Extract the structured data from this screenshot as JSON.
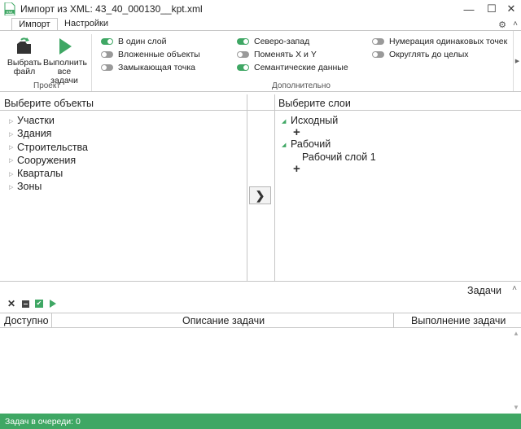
{
  "window": {
    "title": "Импорт из XML: 43_40_000130__kpt.xml",
    "icon": "xml-file-icon",
    "icon_label": "XML",
    "minimize_glyph": "—",
    "maximize_glyph": "☐",
    "close_glyph": "✕"
  },
  "tabs": [
    {
      "label": "Импорт",
      "active": true
    },
    {
      "label": "Настройки",
      "active": false
    }
  ],
  "ribbon": {
    "gear_glyph": "⚙",
    "help_glyph": "˄",
    "scroll_glyph": "▶",
    "project_group": {
      "label": "Проект",
      "buttons": [
        {
          "line1": "Выбрать",
          "line2": "файл",
          "icon": "open-file-icon"
        },
        {
          "line1": "Выполнить",
          "line2": "все задачи",
          "icon": "run-icon"
        }
      ]
    },
    "additional_group": {
      "label": "Дополнительно",
      "toggles": [
        {
          "label": "В один слой",
          "on": true
        },
        {
          "label": "Вложенные объекты",
          "on": false
        },
        {
          "label": "Замыкающая точка",
          "on": false
        },
        {
          "label": "Северо-запад",
          "on": true
        },
        {
          "label": "Поменять X и Y",
          "on": false
        },
        {
          "label": "Семантические данные",
          "on": true
        },
        {
          "label": "Нумерация одинаковых точек",
          "on": false
        },
        {
          "label": "Округлять до целых",
          "on": false
        }
      ]
    }
  },
  "objects_panel": {
    "header": "Выберите объекты",
    "items": [
      "Участки",
      "Здания",
      "Строительства",
      "Сооружения",
      "Кварталы",
      "Зоны"
    ]
  },
  "move_button_glyph": "❯",
  "layers_panel": {
    "header": "Выберите слои",
    "groups": [
      {
        "label": "Исходный",
        "children": []
      },
      {
        "label": "Рабочий",
        "children": [
          "Рабочий слой 1"
        ]
      }
    ],
    "plus_glyph": "+"
  },
  "tasks": {
    "title": "Задачи",
    "collapse_glyph": "˄",
    "toolbar": {
      "delete_glyph": "✕",
      "check_glyph": "✔"
    },
    "columns": [
      "Доступно",
      "Описание задачи",
      "Выполнение задачи"
    ],
    "rows": []
  },
  "status": {
    "queue_text": "Задач в очереди: 0"
  },
  "colors": {
    "accent": "#3fa764",
    "toggle_off": "#9a9a9a",
    "border": "#c6c6c6"
  }
}
